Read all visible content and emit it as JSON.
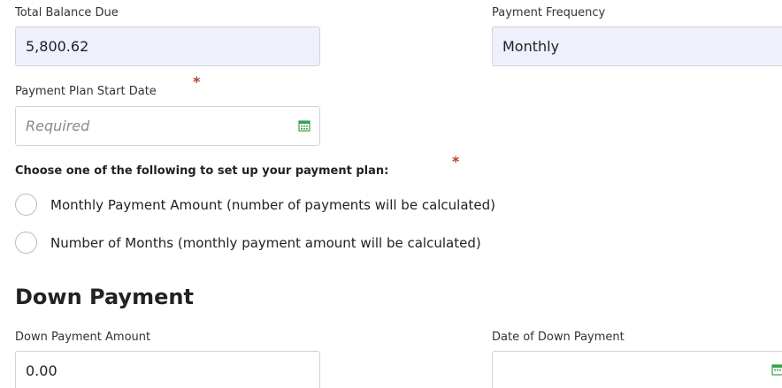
{
  "balance": {
    "label": "Total Balance Due",
    "value": "5,800.62"
  },
  "frequency": {
    "label": "Payment Frequency",
    "value": "Monthly"
  },
  "start_date": {
    "label": "Payment Plan Start Date",
    "required_mark": "*",
    "placeholder": "Required"
  },
  "plan_choice": {
    "label": "Choose one of the following to set up your payment plan:",
    "required_mark": "*",
    "options": [
      {
        "label": "Monthly Payment Amount (number of payments will be calculated)"
      },
      {
        "label": "Number of Months (monthly payment amount will be calculated)"
      }
    ]
  },
  "down_payment": {
    "title": "Down Payment",
    "amount_label": "Down Payment Amount",
    "amount_value": "0.00",
    "date_label": "Date of Down Payment",
    "date_value": ""
  },
  "icons": {
    "calendar": "calendar-icon"
  },
  "colors": {
    "readonly_bg": "#eef0fb",
    "required_star": "#c0392b",
    "calendar_icon": "#3aa04a"
  }
}
